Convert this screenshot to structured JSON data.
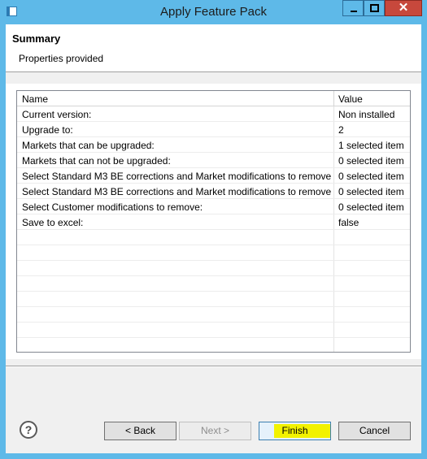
{
  "window": {
    "title": "Apply Feature Pack",
    "close_glyph": "✕"
  },
  "header": {
    "title": "Summary",
    "description": "Properties provided"
  },
  "table": {
    "columns": [
      "Name",
      "Value"
    ],
    "rows": [
      {
        "name": "Current version:",
        "value": "Non installed"
      },
      {
        "name": "Upgrade to:",
        "value": "2"
      },
      {
        "name": "Markets that can be upgraded:",
        "value": "1 selected item"
      },
      {
        "name": "Markets that can not be upgraded:",
        "value": "0 selected item"
      },
      {
        "name": "Select Standard M3 BE corrections and Market modifications to remove:",
        "value": "0 selected item"
      },
      {
        "name": "Select Standard M3 BE corrections and Market modifications to remove:",
        "value": "0 selected item"
      },
      {
        "name": "Select Customer modifications to remove:",
        "value": "0 selected item"
      },
      {
        "name": "Save to excel:",
        "value": "false"
      }
    ]
  },
  "footer": {
    "help_glyph": "?",
    "back_label": "< Back",
    "next_label": "Next >",
    "finish_label": "Finish",
    "cancel_label": "Cancel"
  },
  "colors": {
    "window_frame": "#5eb9e8",
    "close_button": "#c7483c",
    "finish_highlight": "#f2f200"
  },
  "icons": [
    "app-icon",
    "minimize-icon",
    "maximize-icon",
    "close-icon",
    "help-icon"
  ]
}
